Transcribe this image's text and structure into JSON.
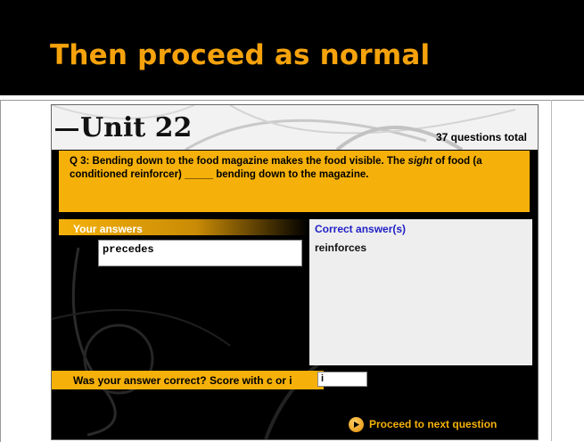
{
  "slide": {
    "title": "Then proceed as normal"
  },
  "app": {
    "unit_title": "Unit 22",
    "questions_total": "37 questions total",
    "question": {
      "prefix": "Q 3: Bending down to the food magazine makes the food visible. The ",
      "emphasis": "sight",
      "suffix": " of food (a conditioned reinforcer) _____ bending down to the magazine."
    },
    "your_answers_label": "Your answers",
    "your_answer_value": "precedes",
    "correct_label": "Correct answer(s)",
    "correct_value": "reinforces",
    "score_prompt": "Was your answer correct? Score with c or i",
    "score_value": "i",
    "proceed_label": "Proceed to next question",
    "proceed_icon": "play-circle-icon",
    "colors": {
      "accent": "#f5b10a",
      "title": "#f5a20c",
      "link_blue": "#1f1fc7"
    }
  }
}
